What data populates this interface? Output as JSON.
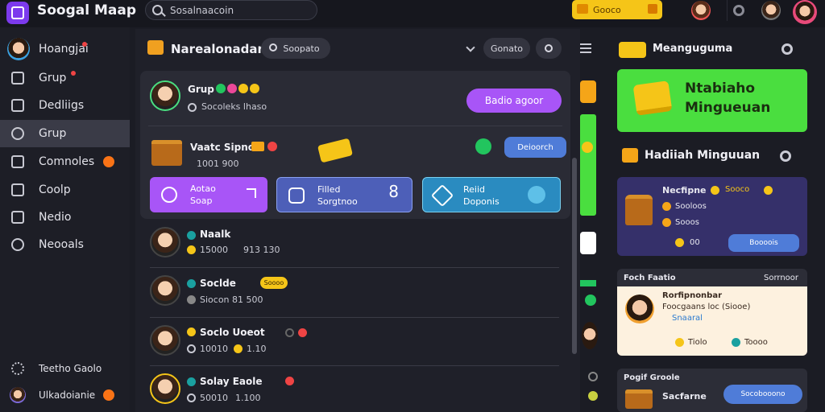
{
  "header": {
    "app_title": "Soogal Maap",
    "search_placeholder": "Sosalnaacoin",
    "yellow_button": "Gooco"
  },
  "sidebar": {
    "items": [
      {
        "label": "Hoangjai",
        "icon": "avatar"
      },
      {
        "label": "Grup",
        "icon": "bookmark-icon"
      },
      {
        "label": "Dedliigs",
        "icon": "bag-icon"
      },
      {
        "label": "Grup",
        "icon": "chat-icon",
        "active": true
      },
      {
        "label": "Comnoles",
        "icon": "home-icon"
      },
      {
        "label": "Coolp",
        "icon": "chart-icon"
      },
      {
        "label": "Nedio",
        "icon": "media-icon"
      },
      {
        "label": "Neooals",
        "icon": "link-icon"
      }
    ],
    "bottom": [
      {
        "label": "Teetho Gaolo",
        "icon": "gear-icon"
      },
      {
        "label": "Ulkadoianie",
        "icon": "avatar"
      }
    ]
  },
  "main": {
    "title": "Narealonadan",
    "search_pill": "Soopato",
    "pill_right": "Gonato",
    "card": {
      "user_name": "Grup",
      "user_sub": "Socoleks lhaso",
      "purple_button": "Badio agoor",
      "feature_title": "Vaatc Sipno",
      "feature_sub": "1001 900",
      "blue_button": "Deioorch",
      "tiles": [
        {
          "line1": "Aotao",
          "line2": "Soap",
          "color": "#a855f7"
        },
        {
          "line1": "Filled",
          "line2": "Sorgtnoo",
          "color": "#4d5fb8"
        },
        {
          "line1": "Reiid",
          "line2": "Doponis",
          "color": "#2a8bc0"
        }
      ]
    },
    "rows": [
      {
        "name": "Naalk",
        "meta": "15000",
        "meta2": "913 130"
      },
      {
        "name": "Soclde",
        "meta": "Siocon",
        "meta2": "81 500",
        "tag": "Soooo"
      },
      {
        "name": "Soclo Uoeot",
        "meta": "10010",
        "meta2": "1.10"
      },
      {
        "name": "Solay Eaole",
        "meta": "50010",
        "meta2": "1.100"
      }
    ]
  },
  "right": {
    "title": "Meanguguma",
    "banner_line1": "Ntabiaho",
    "banner_line2": "Mingueuan",
    "section_title": "Hadiiah Minguuan",
    "purple_card": {
      "name": "Necfipne",
      "tag": "Sooco",
      "line1": "Sooloos",
      "line2": "Sooos",
      "btn": "Boooois",
      "val": "00"
    },
    "cream_card": {
      "header_left": "Foch Faatio",
      "header_right": "Sorrnoor",
      "name": "Rorfipnonbar",
      "sub": "Foocgaans loc (Siooe)",
      "link": "Snaaral",
      "stat": "Tiolo",
      "btn": "Toooo"
    },
    "bottom_card": {
      "title": "Pogif Groole",
      "name": "Sacfarne",
      "btn": "Socobooono"
    }
  }
}
